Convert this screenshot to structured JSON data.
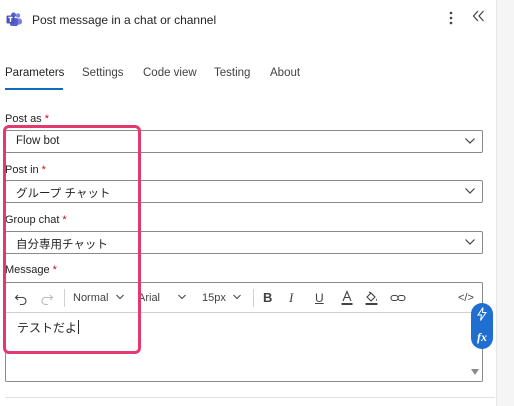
{
  "header": {
    "title": "Post message in a chat or channel",
    "app_icon": "teams-icon",
    "more_icon": "more-vertical-icon",
    "collapse_icon": "collapse-icon",
    "accent": "#5b5fc7"
  },
  "tabs": [
    {
      "label": "Parameters",
      "active": true
    },
    {
      "label": "Settings",
      "active": false
    },
    {
      "label": "Code view",
      "active": false
    },
    {
      "label": "Testing",
      "active": false
    },
    {
      "label": "About",
      "active": false
    }
  ],
  "fields": {
    "post_as": {
      "label": "Post as",
      "required_mark": "*",
      "value": "Flow bot"
    },
    "post_in": {
      "label": "Post in",
      "required_mark": "*",
      "value": "グループ チャット"
    },
    "group_chat": {
      "label": "Group chat",
      "required_mark": "*",
      "value": "自分専用チャット"
    },
    "message": {
      "label": "Message",
      "required_mark": "*",
      "value": "テストだよ"
    }
  },
  "toolbar": {
    "font_style": "Normal",
    "font_family": "Arial",
    "font_size": "15px",
    "bold": "B",
    "italic": "I",
    "underline": "U",
    "code_view": "</>"
  },
  "side_actions": {
    "dynamic_content_icon": "lightning-icon",
    "expression_icon": "fx-icon",
    "expression_label": "fx",
    "color": "#1f6fd1"
  },
  "highlight_color": "#e23a6e"
}
